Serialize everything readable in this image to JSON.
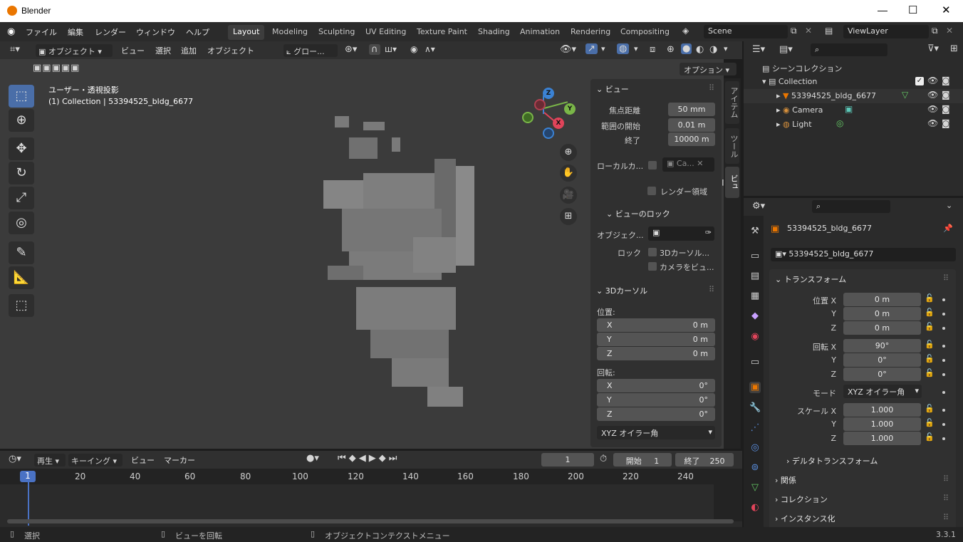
{
  "window": {
    "title": "Blender",
    "min": "—",
    "max": "☐",
    "close": "✕"
  },
  "menu": [
    "ファイル",
    "編集",
    "レンダー",
    "ウィンドウ",
    "ヘルプ"
  ],
  "workspaces": [
    "Layout",
    "Modeling",
    "Sculpting",
    "UV Editing",
    "Texture Paint",
    "Shading",
    "Animation",
    "Rendering",
    "Compositing"
  ],
  "scene": {
    "name": "Scene",
    "viewlayer": "ViewLayer"
  },
  "header": {
    "mode": "オブジェクト",
    "view": "ビュー",
    "select": "選択",
    "add": "追加",
    "object": "オブジェクト",
    "transform": "グロー...",
    "options": "オプション"
  },
  "viewport": {
    "title": "ユーザー・透視投影",
    "subtitle": "(1) Collection | 53394525_bldg_6677"
  },
  "gizmo": {
    "x": "X",
    "y": "Y",
    "z": "Z"
  },
  "npanel": {
    "tabs": [
      "アイテム",
      "ツール",
      "ビュー"
    ],
    "view_title": "ビュー",
    "focal_label": "焦点距離",
    "focal_value": "50 mm",
    "clip_start_label": "範囲の開始",
    "clip_start_value": "0.01 m",
    "clip_end_label": "終了",
    "clip_end_value": "10000 m",
    "local_cam_label": "ローカルカ...",
    "local_cam_value": "Ca...",
    "render_region": "レンダー領域",
    "view_lock_title": "ビューのロック",
    "lock_object_label": "オブジェク...",
    "lock_label": "ロック",
    "lock_3dcursor": "3Dカーソル...",
    "lock_camera": "カメラをビュ...",
    "cursor_title": "3Dカーソル",
    "location_label": "位置:",
    "loc_x": "0 m",
    "loc_y": "0 m",
    "loc_z": "0 m",
    "rotation_label": "回転:",
    "rot_x": "0°",
    "rot_y": "0°",
    "rot_z": "0°",
    "rot_mode": "XYZ オイラー角"
  },
  "outliner": {
    "scene_collection": "シーンコレクション",
    "collection": "Collection",
    "items": [
      "53394525_bldg_6677",
      "Camera",
      "Light"
    ]
  },
  "properties": {
    "object_name": "53394525_bldg_6677",
    "data_name": "53394525_bldg_6677",
    "transform_title": "トランスフォーム",
    "loc_label": "位置 X",
    "loc_x": "0 m",
    "loc_y": "0 m",
    "loc_z": "0 m",
    "rot_label": "回転 X",
    "rot_x": "90°",
    "rot_y": "0°",
    "rot_z": "0°",
    "mode_label": "モード",
    "mode_value": "XYZ オイラー角",
    "scale_label": "スケール X",
    "scale_x": "1.000",
    "scale_y": "1.000",
    "scale_z": "1.000",
    "y": "Y",
    "z": "Z",
    "delta": "デルタトランスフォーム",
    "relations": "関係",
    "collections": "コレクション",
    "instancing": "インスタンス化"
  },
  "timeline": {
    "playback": "再生",
    "keying": "キーイング",
    "view": "ビュー",
    "marker": "マーカー",
    "current_frame": "1",
    "start_label": "開始",
    "start_value": "1",
    "end_label": "終了",
    "end_value": "250",
    "ticks": [
      "1",
      "20",
      "40",
      "60",
      "80",
      "100",
      "120",
      "140",
      "160",
      "180",
      "200",
      "220",
      "240"
    ]
  },
  "status": {
    "select": "選択",
    "rotate": "ビューを回転",
    "context": "オブジェクトコンテクストメニュー",
    "version": "3.3.1"
  }
}
